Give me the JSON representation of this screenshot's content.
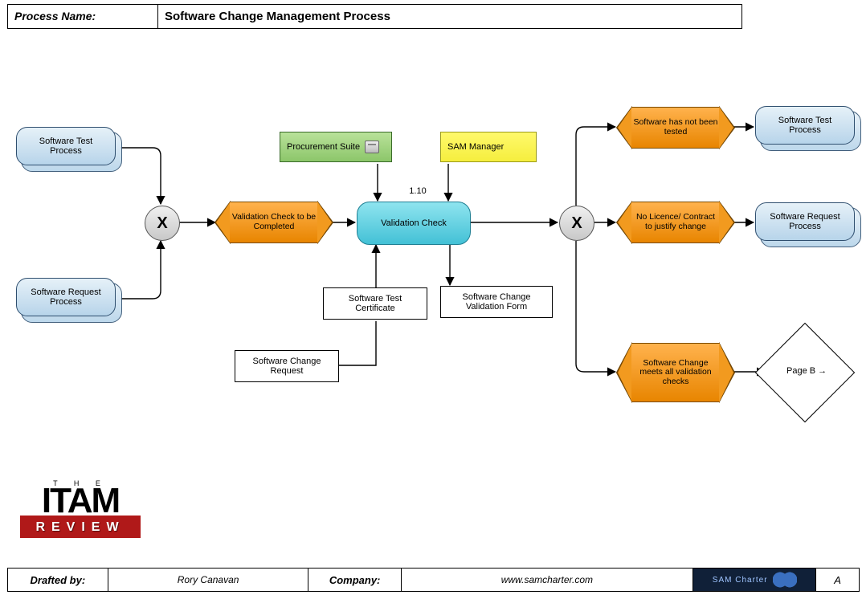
{
  "header": {
    "label": "Process Name:",
    "value": "Software Change Management Process"
  },
  "nodes": {
    "software_test_process_in": "Software Test Process",
    "software_request_process_in": "Software Request Process",
    "xor1": "X",
    "validation_to_complete": "Validation Check to be Completed",
    "procurement_suite": "Procurement Suite",
    "sam_manager": "SAM Manager",
    "step_number": "1.10",
    "validation_check": "Validation Check",
    "software_test_certificate": "Software Test Certificate",
    "software_change_request": "Software Change Request",
    "software_change_validation_form": "Software Change Validation Form",
    "xor2": "X",
    "not_tested": "Software has not been tested",
    "no_licence": "No Licence/ Contract to justify change",
    "meets_checks": "Software Change meets all validation checks",
    "software_test_process_out": "Software Test Process",
    "software_request_process_out": "Software Request Process",
    "page_b": "Page B  →"
  },
  "footer": {
    "drafted_by_label": "Drafted by:",
    "drafted_by_value": "Rory Canavan",
    "company_label": "Company:",
    "company_value": "www.samcharter.com",
    "logo_text": "SAM Charter",
    "page": "A"
  },
  "logo": {
    "the": "T H E",
    "itam": "ITAM",
    "review": "REVIEW"
  }
}
